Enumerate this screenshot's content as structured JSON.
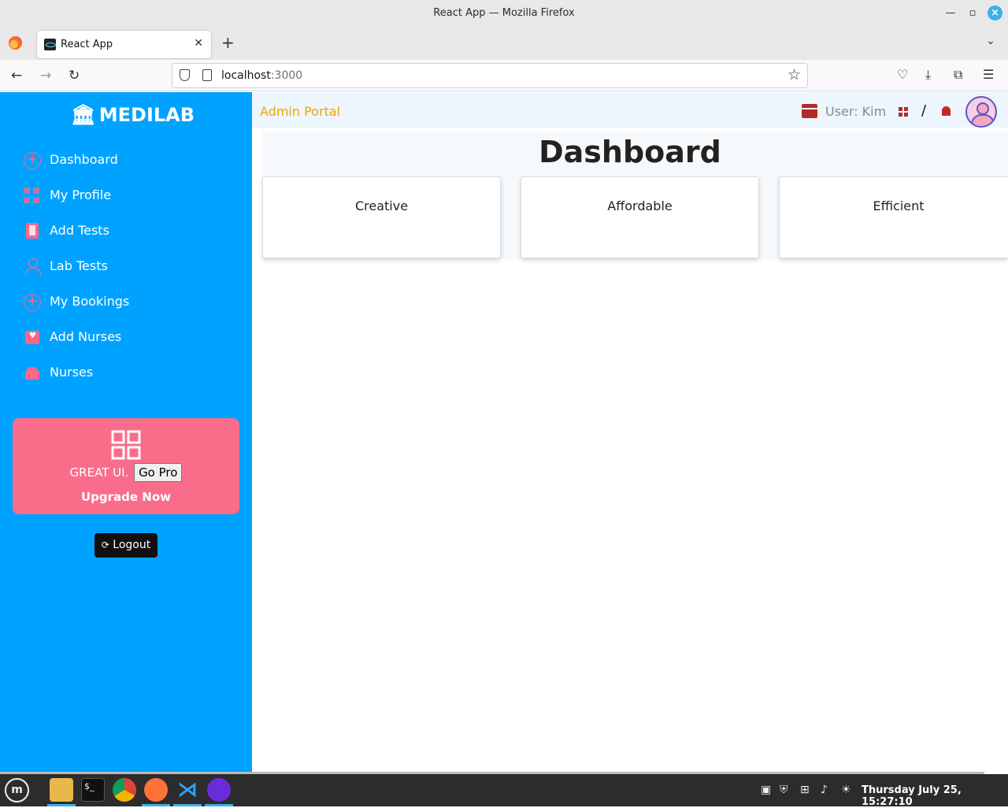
{
  "window": {
    "title": "React App — Mozilla Firefox"
  },
  "browser": {
    "tab_title": "React App",
    "url_host": "localhost",
    "url_port": ":3000"
  },
  "sidebar": {
    "brand": "MEDILAB",
    "items": [
      {
        "label": "Dashboard",
        "icon": "plus-circle-icon"
      },
      {
        "label": "My Profile",
        "icon": "grid-icon"
      },
      {
        "label": "Add Tests",
        "icon": "book-icon"
      },
      {
        "label": "Lab Tests",
        "icon": "person-icon"
      },
      {
        "label": "My Bookings",
        "icon": "plus-circle-icon"
      },
      {
        "label": "Add Nurses",
        "icon": "gift-icon"
      },
      {
        "label": "Nurses",
        "icon": "alarm-icon"
      }
    ],
    "promo": {
      "text": "GREAT UI.",
      "button": "Go Pro",
      "cta": "Upgrade Now"
    },
    "logout": "Logout"
  },
  "topbar": {
    "portal": "Admin Portal",
    "user": "User: Kim",
    "separator": "/"
  },
  "main": {
    "title": "Dashboard",
    "cards": [
      "Creative",
      "Affordable",
      "Efficient"
    ]
  },
  "taskbar": {
    "clock": "Thursday July 25, 15:27:10"
  },
  "colors": {
    "sidebar_bg": "#00a2ff",
    "accent_pink": "#f96d8b",
    "portal_orange": "#f0a500",
    "icon_red": "#b22a2a"
  }
}
